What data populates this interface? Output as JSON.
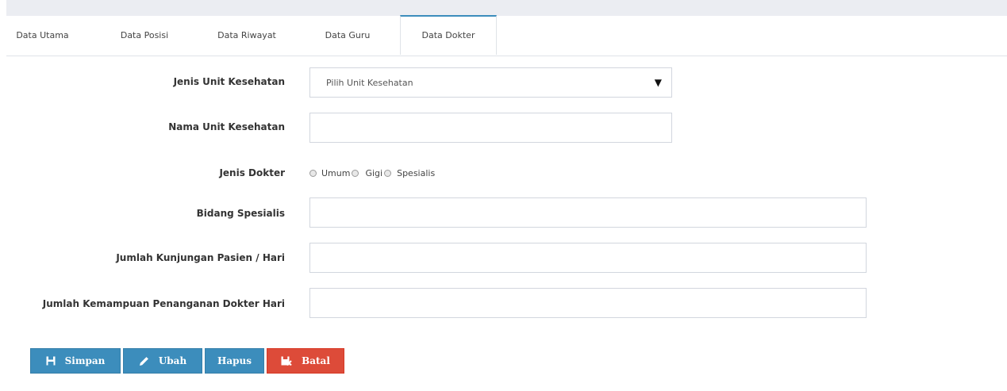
{
  "tabs": [
    {
      "label": "Data Utama",
      "active": false
    },
    {
      "label": "Data Posisi",
      "active": false
    },
    {
      "label": "Data Riwayat",
      "active": false
    },
    {
      "label": "Data Guru",
      "active": false
    },
    {
      "label": "Data Dokter",
      "active": true
    }
  ],
  "form": {
    "jenis_unit": {
      "label": "Jenis Unit Kesehatan",
      "selected": "Pilih Unit Kesehatan"
    },
    "nama_unit": {
      "label": "Nama Unit Kesehatan",
      "value": "",
      "placeholder": ""
    },
    "jenis_dokter": {
      "label": "Jenis Dokter",
      "options": [
        "Umum",
        "Gigi",
        "Spesialis"
      ]
    },
    "bidang_spesialis": {
      "label": "Bidang Spesialis",
      "value": "",
      "placeholder": ""
    },
    "jumlah_kunjungan": {
      "label": "Jumlah Kunjungan Pasien / Hari",
      "value": "",
      "placeholder": ""
    },
    "jumlah_kemampuan": {
      "label": "Jumlah Kemampuan Penanganan Dokter Hari",
      "value": "",
      "placeholder": ""
    }
  },
  "buttons": {
    "simpan": "Simpan",
    "ubah": "Ubah",
    "hapus": "Hapus",
    "batal": "Batal"
  },
  "icons": {
    "simpan": "save-icon",
    "ubah": "pencil-icon",
    "batal": "cancel-icon",
    "dropdown": "caret-down-icon"
  },
  "colors": {
    "primary": "#3c8dbc",
    "danger": "#dd4b39",
    "tab_active_border": "#3c8dbc",
    "top_strip": "#ebedf2"
  }
}
